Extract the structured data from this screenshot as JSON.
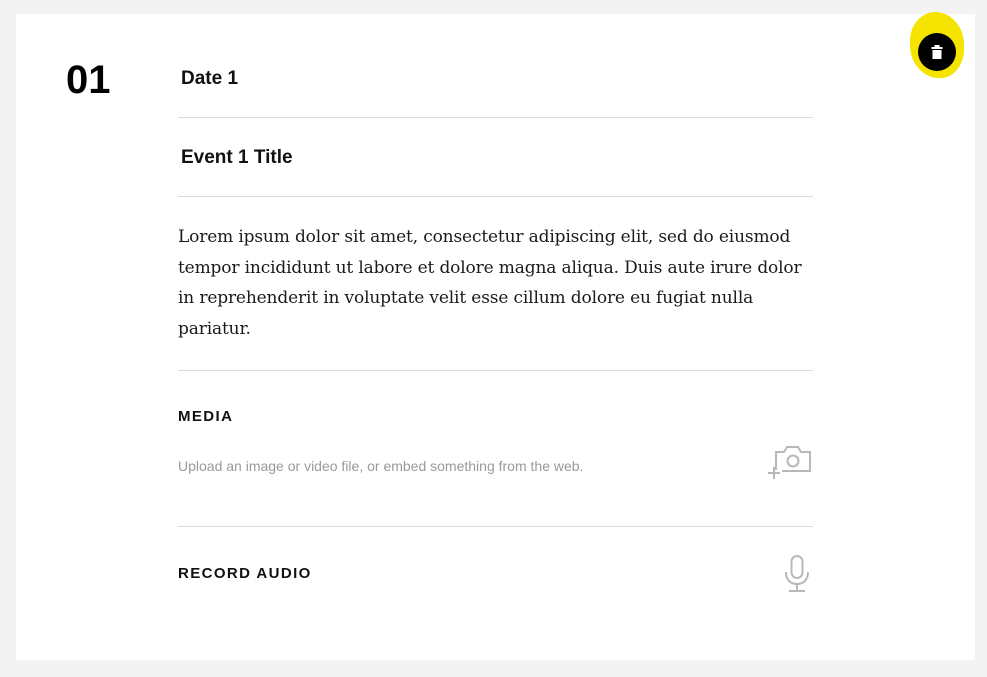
{
  "event": {
    "number": "01",
    "date": "Date 1",
    "title": "Event 1 Title",
    "description": "Lorem ipsum dolor sit amet, consectetur adipiscing elit, sed do eiusmod tempor incididunt ut labore et dolore magna aliqua. Duis aute irure dolor in reprehenderit in voluptate velit esse cillum dolore eu fugiat nulla pariatur."
  },
  "media": {
    "label": "MEDIA",
    "help_text": "Upload an image or video file, or embed something from the web.",
    "icon": "add-photo-icon"
  },
  "audio": {
    "label": "RECORD AUDIO",
    "icon": "microphone-icon"
  },
  "delete": {
    "icon": "trash-icon",
    "highlight_color": "#f5e400"
  }
}
